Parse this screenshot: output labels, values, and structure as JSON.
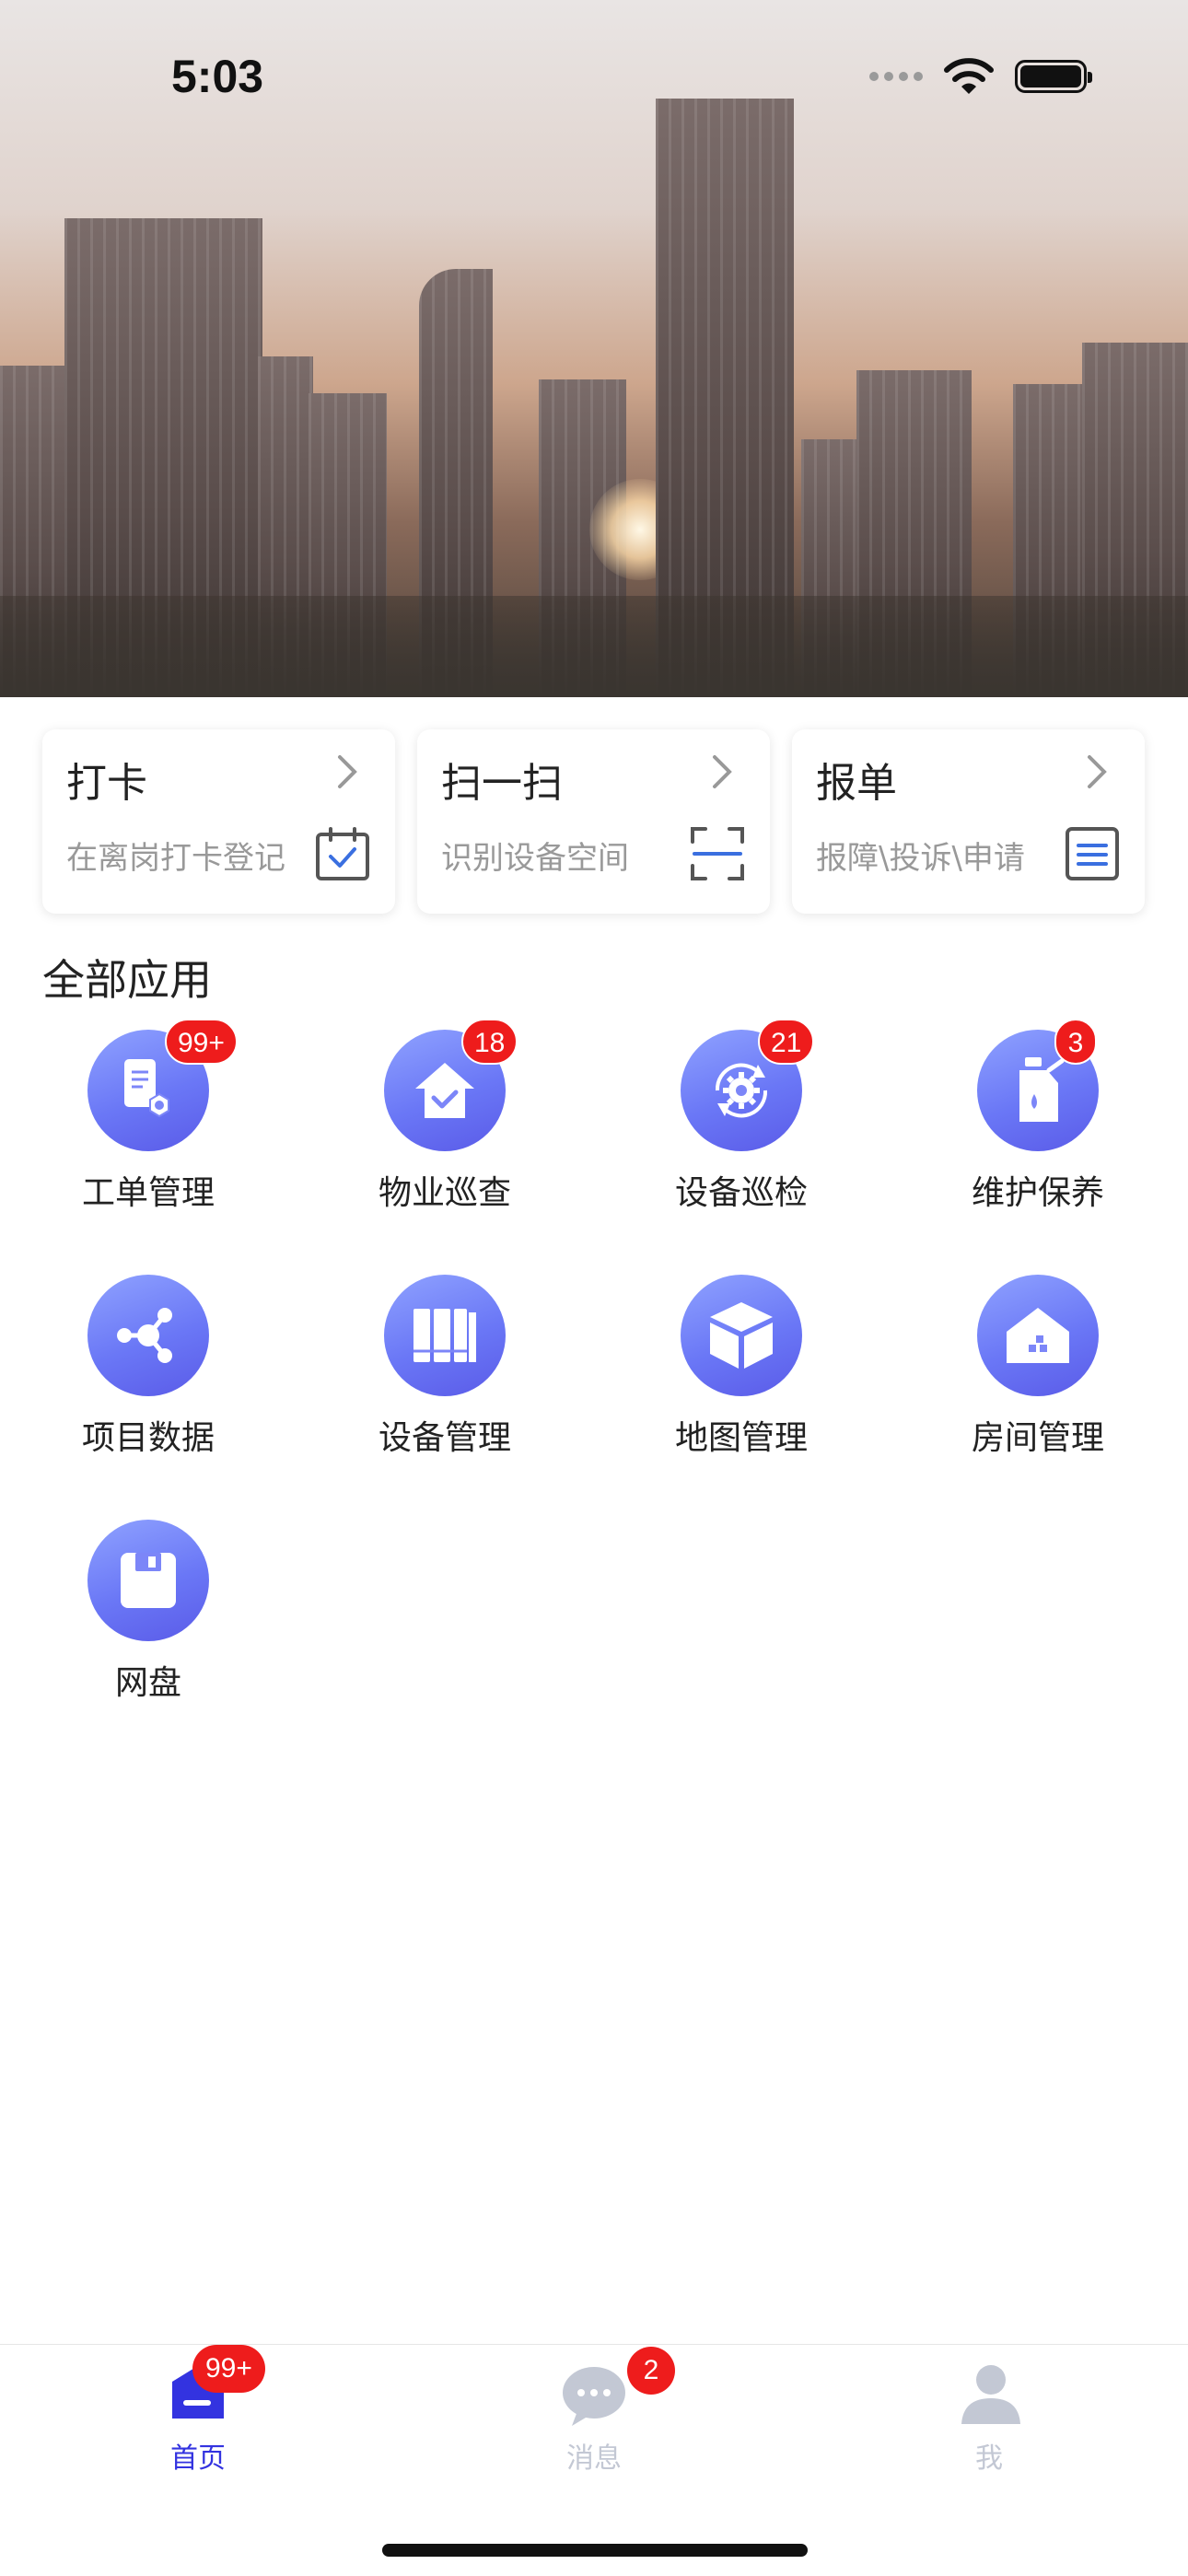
{
  "status_bar": {
    "time": "5:03",
    "icons": [
      "signal-icon",
      "wifi-icon",
      "battery-icon"
    ]
  },
  "hero": {
    "description_icon": "city-skyline-banner"
  },
  "quick_cards": [
    {
      "title": "打卡",
      "subtitle": "在离岗打卡登记",
      "icon": "calendar-check-icon"
    },
    {
      "title": "扫一扫",
      "subtitle": "识别设备空间",
      "icon": "scan-icon"
    },
    {
      "title": "报单",
      "subtitle": "报障\\投诉\\申请",
      "icon": "list-document-icon"
    }
  ],
  "section_title": "全部应用",
  "apps": [
    {
      "label": "工单管理",
      "badge": "99+",
      "icon": "work-order-icon"
    },
    {
      "label": "物业巡查",
      "badge": "18",
      "icon": "house-check-icon"
    },
    {
      "label": "设备巡检",
      "badge": "21",
      "icon": "gear-refresh-icon"
    },
    {
      "label": "维护保养",
      "badge": "3",
      "icon": "oil-can-icon"
    },
    {
      "label": "项目数据",
      "badge": "",
      "icon": "network-icon"
    },
    {
      "label": "设备管理",
      "badge": "",
      "icon": "binders-icon"
    },
    {
      "label": "地图管理",
      "badge": "",
      "icon": "cube-icon"
    },
    {
      "label": "房间管理",
      "badge": "",
      "icon": "room-icon"
    },
    {
      "label": "网盘",
      "badge": "",
      "icon": "floppy-disk-icon"
    }
  ],
  "tabs": [
    {
      "label": "首页",
      "badge": "99+",
      "active": true,
      "icon": "home-icon"
    },
    {
      "label": "消息",
      "badge": "2",
      "active": false,
      "icon": "message-icon"
    },
    {
      "label": "我",
      "badge": "",
      "active": false,
      "icon": "user-icon"
    }
  ],
  "colors": {
    "accent": "#3333e0",
    "badge": "#ee1c1c",
    "icon_gradient_top": "#8fa2ff",
    "icon_gradient_bottom": "#5a5be8",
    "inactive_tab": "#c3c8d4"
  }
}
